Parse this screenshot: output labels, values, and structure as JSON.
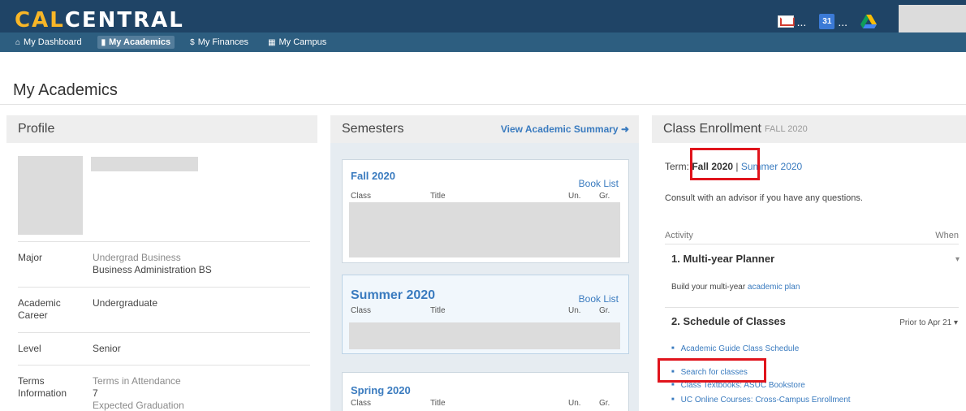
{
  "app": {
    "logo_cal": "CAL",
    "logo_central": "CENTRAL",
    "mail_count": "...",
    "cal_day": "31",
    "cal_count": "..."
  },
  "nav": [
    {
      "label": "My Dashboard",
      "icon": "home-icon",
      "active": false
    },
    {
      "label": "My Academics",
      "icon": "book-icon",
      "active": true
    },
    {
      "label": "My Finances",
      "icon": "dollar-icon",
      "active": false
    },
    {
      "label": "My Campus",
      "icon": "campus-icon",
      "active": false
    }
  ],
  "page_title": "My Academics",
  "profile": {
    "title": "Profile",
    "rows": [
      {
        "label": "Major",
        "value1": "Undergrad Business",
        "value2": "Business Administration BS"
      },
      {
        "label": "Academic Career",
        "value1": "Undergraduate"
      },
      {
        "label": "Level",
        "value1": "Senior"
      },
      {
        "label": "Terms Information",
        "value1": "Terms in Attendance",
        "value2": "7",
        "value3": "Expected Graduation"
      }
    ]
  },
  "semesters": {
    "title": "Semesters",
    "summary_link": "View Academic Summary",
    "cards": [
      {
        "name": "Fall 2020",
        "book_list": "Book List",
        "col_class": "Class",
        "col_title": "Title",
        "col_units": "Un.",
        "col_grade": "Gr."
      },
      {
        "name": "Summer 2020",
        "book_list": "Book List",
        "col_class": "Class",
        "col_title": "Title",
        "col_units": "Un.",
        "col_grade": "Gr."
      },
      {
        "name": "Spring 2020",
        "col_class": "Class",
        "col_title": "Title",
        "col_units": "Un.",
        "col_grade": "Gr."
      }
    ]
  },
  "enrollment": {
    "title": "Class Enrollment",
    "term_tag": "FALL 2020",
    "term_label": "Term:",
    "term_current": "Fall 2020",
    "term_sep": "|",
    "term_other": "Summer 2020",
    "consult": "Consult with an advisor if you have any questions.",
    "activity": "Activity",
    "when": "When",
    "step1": "1. Multi-year Planner",
    "step1_text": "Build your multi-year ",
    "step1_link": "academic plan",
    "step2": "2. Schedule of Classes",
    "step2_when": "Prior to Apr 21",
    "links": [
      "Academic Guide Class Schedule",
      "Search for classes",
      "Class Textbooks: ASUC Bookstore",
      "UC Online Courses: Cross-Campus Enrollment"
    ]
  },
  "colors": {
    "header": "#1f4466",
    "nav": "#2d5e80",
    "accent": "#f8b627",
    "link": "#3a7bbf",
    "highlight": "#e0141c"
  }
}
